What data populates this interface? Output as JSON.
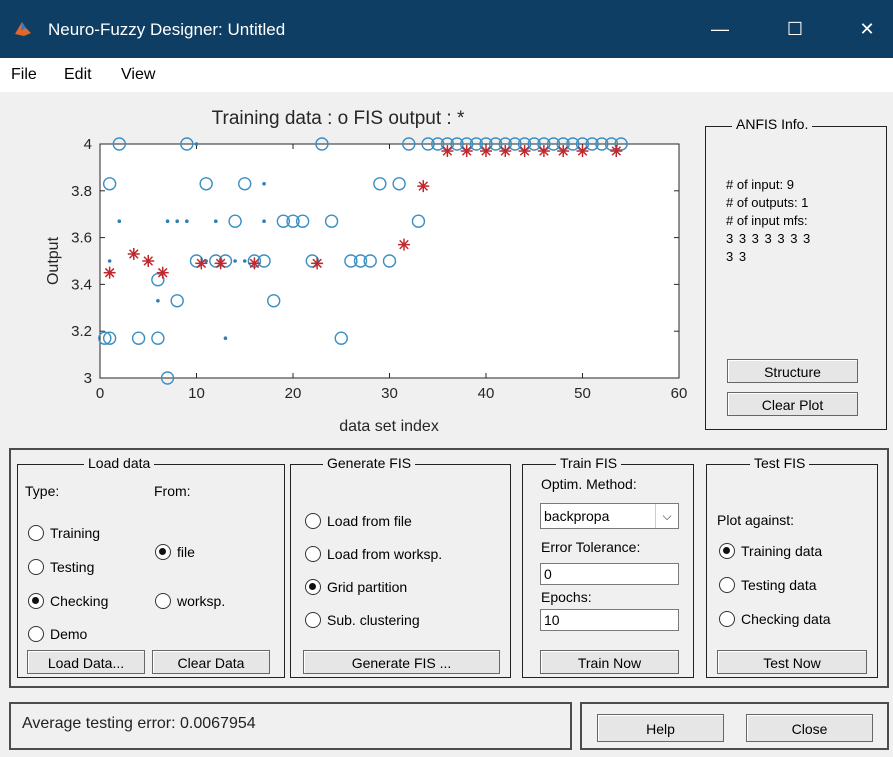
{
  "window": {
    "title": "Neuro-Fuzzy Designer: Untitled",
    "minimize_icon": "minimize-icon",
    "maximize_icon": "maximize-icon",
    "close_icon": "close-icon",
    "app_icon": "matlab-icon"
  },
  "menu": {
    "file": "File",
    "edit": "Edit",
    "view": "View"
  },
  "plot": {
    "title": "Training data : o   FIS output : *",
    "xlabel": "data set index",
    "ylabel": "Output",
    "xticks": [
      "0",
      "10",
      "20",
      "30",
      "40",
      "50",
      "60"
    ],
    "yticks": [
      "3",
      "3.2",
      "3.4",
      "3.6",
      "3.8",
      "4"
    ],
    "colors": {
      "data": "#3a8fc2",
      "fis": "#c0282d",
      "dots": "#2f7fb4"
    }
  },
  "chart_data": {
    "type": "scatter",
    "title": "Training data : o   FIS output : *",
    "xlabel": "data set index",
    "ylabel": "Output",
    "xlim": [
      0,
      60
    ],
    "ylim": [
      3,
      4
    ],
    "series": [
      {
        "name": "Training data",
        "marker": "o",
        "points": [
          [
            0.5,
            3.17
          ],
          [
            1,
            3.83
          ],
          [
            2,
            4.0
          ],
          [
            1,
            3.17
          ],
          [
            4,
            3.17
          ],
          [
            6,
            3.17
          ],
          [
            6,
            3.42
          ],
          [
            7,
            3
          ],
          [
            8,
            3.33
          ],
          [
            9,
            4.0
          ],
          [
            10,
            3.5
          ],
          [
            11,
            3.83
          ],
          [
            12,
            3.5
          ],
          [
            13,
            3.5
          ],
          [
            14,
            3.67
          ],
          [
            15,
            3.83
          ],
          [
            16,
            3.5
          ],
          [
            17,
            3.5
          ],
          [
            18,
            3.33
          ],
          [
            19,
            3.67
          ],
          [
            20,
            3.67
          ],
          [
            21,
            3.67
          ],
          [
            22,
            3.5
          ],
          [
            23,
            4.0
          ],
          [
            24,
            3.67
          ],
          [
            25,
            3.17
          ],
          [
            26,
            3.5
          ],
          [
            27,
            3.5
          ],
          [
            28,
            3.5
          ],
          [
            29,
            3.83
          ],
          [
            30,
            3.5
          ],
          [
            31,
            3.83
          ],
          [
            33,
            3.67
          ],
          [
            32,
            4.0
          ],
          [
            34,
            4.0
          ],
          [
            35,
            4.0
          ],
          [
            36,
            4.0
          ],
          [
            37,
            4.0
          ],
          [
            38,
            4.0
          ],
          [
            39,
            4.0
          ],
          [
            40,
            4.0
          ],
          [
            41,
            4.0
          ],
          [
            42,
            4.0
          ],
          [
            43,
            4.0
          ],
          [
            44,
            4.0
          ],
          [
            45,
            4.0
          ],
          [
            46,
            4.0
          ],
          [
            47,
            4.0
          ],
          [
            48,
            4.0
          ],
          [
            49,
            4.0
          ],
          [
            50,
            4.0
          ],
          [
            51,
            4.0
          ],
          [
            52,
            4.0
          ],
          [
            53,
            4.0
          ],
          [
            54,
            4.0
          ]
        ]
      },
      {
        "name": "FIS output",
        "marker": "*",
        "points": [
          [
            1,
            3.45
          ],
          [
            3.5,
            3.53
          ],
          [
            5,
            3.5
          ],
          [
            6.5,
            3.45
          ],
          [
            10.5,
            3.49
          ],
          [
            12.5,
            3.49
          ],
          [
            16,
            3.49
          ],
          [
            22.5,
            3.49
          ],
          [
            31.5,
            3.57
          ],
          [
            33.5,
            3.82
          ],
          [
            36,
            3.97
          ],
          [
            38,
            3.97
          ],
          [
            40,
            3.97
          ],
          [
            42,
            3.97
          ],
          [
            44,
            3.97
          ],
          [
            46,
            3.97
          ],
          [
            48,
            3.97
          ],
          [
            50,
            3.97
          ],
          [
            53.5,
            3.97
          ]
        ]
      },
      {
        "name": "dots",
        "marker": ".",
        "points": [
          [
            1,
            3.5
          ],
          [
            2,
            3.67
          ],
          [
            6,
            3.33
          ],
          [
            7,
            3.67
          ],
          [
            8,
            3.67
          ],
          [
            9,
            3.67
          ],
          [
            10,
            4.0
          ],
          [
            11,
            3.5
          ],
          [
            12,
            3.67
          ],
          [
            13,
            3.17
          ],
          [
            14,
            3.5
          ],
          [
            15,
            3.5
          ],
          [
            17,
            3.83
          ],
          [
            17,
            3.67
          ]
        ]
      }
    ]
  },
  "anfis": {
    "title": "ANFIS Info.",
    "inputs": "# of input: 9",
    "outputs": "# of outputs: 1",
    "mfs_label": "# of input mfs:",
    "mfs_line1": "3  3  3  3  3  3  3",
    "mfs_line2": "3  3",
    "structure_button": "Structure",
    "clear_plot_button": "Clear Plot"
  },
  "load_data": {
    "title": "Load data",
    "type_label": "Type:",
    "from_label": "From:",
    "types": [
      {
        "label": "Training",
        "checked": false
      },
      {
        "label": "Testing",
        "checked": false
      },
      {
        "label": "Checking",
        "checked": true
      },
      {
        "label": "Demo",
        "checked": false
      }
    ],
    "sources": [
      {
        "label": "file",
        "checked": true
      },
      {
        "label": "worksp.",
        "checked": false
      }
    ],
    "load_button": "Load Data...",
    "clear_button": "Clear Data"
  },
  "generate": {
    "title": "Generate FIS",
    "options": [
      {
        "label": "Load from file",
        "checked": false
      },
      {
        "label": "Load from worksp.",
        "checked": false
      },
      {
        "label": "Grid partition",
        "checked": true
      },
      {
        "label": "Sub. clustering",
        "checked": false
      }
    ],
    "button": "Generate FIS ..."
  },
  "train": {
    "title": "Train FIS",
    "method_label": "Optim. Method:",
    "method_value": "backpropa",
    "tolerance_label": "Error Tolerance:",
    "tolerance_value": "0",
    "epochs_label": "Epochs:",
    "epochs_value": "10",
    "button": "Train Now"
  },
  "test": {
    "title": "Test FIS",
    "plot_against": "Plot against:",
    "options": [
      {
        "label": "Training data",
        "checked": true
      },
      {
        "label": "Testing data",
        "checked": false
      },
      {
        "label": "Checking data",
        "checked": false
      }
    ],
    "button": "Test Now"
  },
  "status": {
    "text": "Average testing error: 0.0067954"
  },
  "footer": {
    "help": "Help",
    "close": "Close"
  }
}
